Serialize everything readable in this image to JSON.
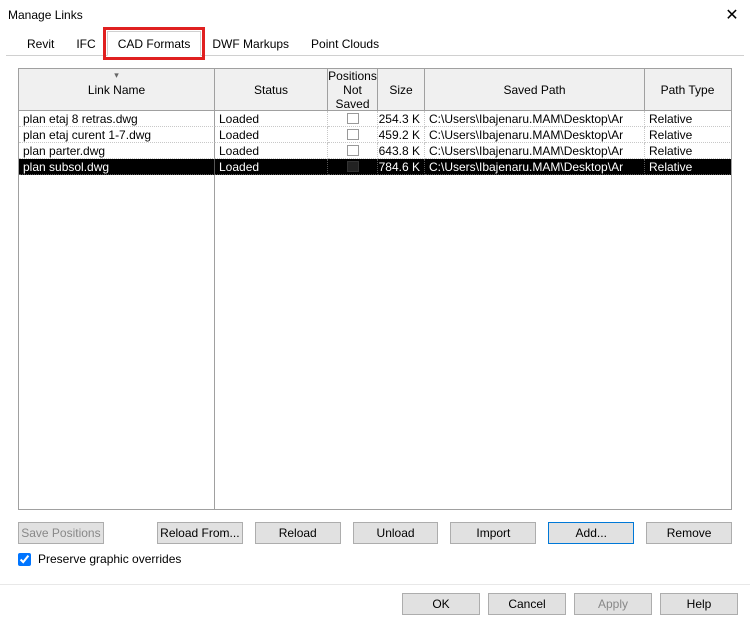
{
  "window": {
    "title": "Manage Links"
  },
  "tabs": {
    "revit": "Revit",
    "ifc": "IFC",
    "cad": "CAD Formats",
    "dwf": "DWF Markups",
    "pointclouds": "Point Clouds"
  },
  "columns": {
    "link_name": "Link Name",
    "status": "Status",
    "positions": "Positions Not Saved",
    "size": "Size",
    "saved_path": "Saved Path",
    "path_type": "Path Type"
  },
  "rows": [
    {
      "name": "plan etaj 8 retras.dwg",
      "status": "Loaded",
      "size": "254.3 K",
      "path": "C:\\Users\\Ibajenaru.MAM\\Desktop\\Ar",
      "path_type": "Relative",
      "selected": false
    },
    {
      "name": "plan etaj curent 1-7.dwg",
      "status": "Loaded",
      "size": "459.2 K",
      "path": "C:\\Users\\Ibajenaru.MAM\\Desktop\\Ar",
      "path_type": "Relative",
      "selected": false
    },
    {
      "name": "plan parter.dwg",
      "status": "Loaded",
      "size": "643.8 K",
      "path": "C:\\Users\\Ibajenaru.MAM\\Desktop\\Ar",
      "path_type": "Relative",
      "selected": false
    },
    {
      "name": "plan subsol.dwg",
      "status": "Loaded",
      "size": "784.6 K",
      "path": "C:\\Users\\Ibajenaru.MAM\\Desktop\\Ar",
      "path_type": "Relative",
      "selected": true
    }
  ],
  "buttons": {
    "save_positions": "Save Positions",
    "reload_from": "Reload From...",
    "reload": "Reload",
    "unload": "Unload",
    "import": "Import",
    "add": "Add...",
    "remove": "Remove"
  },
  "checkbox": {
    "preserve": "Preserve graphic overrides"
  },
  "footer": {
    "ok": "OK",
    "cancel": "Cancel",
    "apply": "Apply",
    "help": "Help"
  }
}
